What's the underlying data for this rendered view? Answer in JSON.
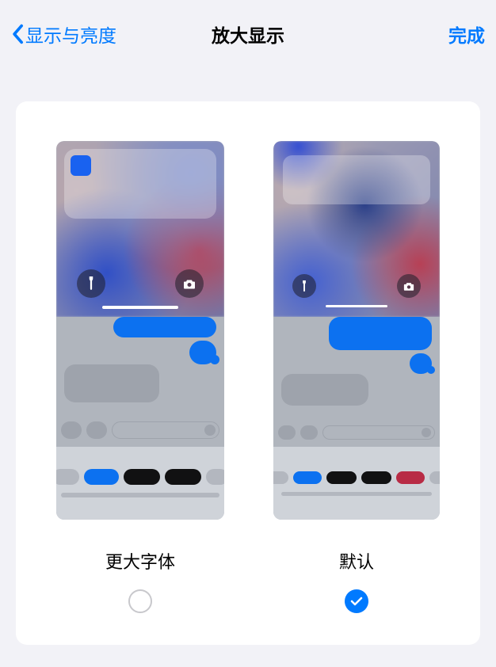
{
  "nav": {
    "back_label": "显示与亮度",
    "title": "放大显示",
    "done_label": "完成"
  },
  "options": {
    "larger": {
      "label": "更大字体",
      "selected": false
    },
    "default": {
      "label": "默认",
      "selected": true
    }
  },
  "colors": {
    "accent": "#007aff",
    "blue_button": "#0c71f0",
    "black_pill": "#111112",
    "red_pill": "#b82b45",
    "gray_pill": "#b3b7bf"
  }
}
